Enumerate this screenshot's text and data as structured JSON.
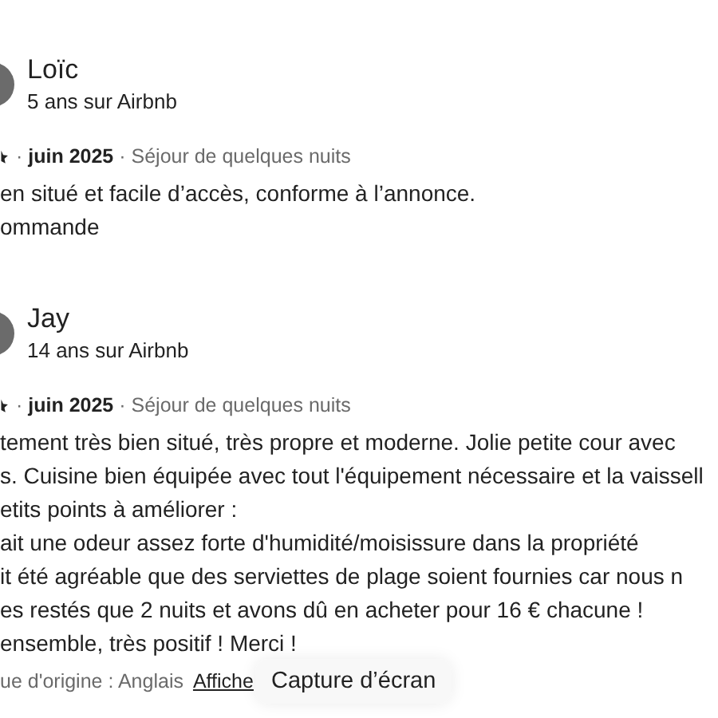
{
  "reviews": [
    {
      "name": "Loïc",
      "tenure": "5 ans sur Airbnb",
      "meta": "· **juin 2025** · Séjour de quelques nuits",
      "lines": [
        "en situé et facile d’accès, conforme à l’annonce.",
        "ommande"
      ]
    },
    {
      "name": "Jay",
      "tenure": "14 ans sur Airbnb",
      "meta": "· **juin 2025** · Séjour de quelques nuits",
      "lines": [
        "tement très bien situé, très propre et moderne. Jolie petite cour avec",
        "s. Cuisine bien équipée avec tout l'équipement nécessaire et la vaissell",
        "etits points à améliorer :",
        "ait une odeur assez forte d'humidité/moisissure dans la propriété",
        "it été agréable que des serviettes de plage soient fournies car nous n",
        "es restés que 2 nuits et avons dû en acheter pour 16 € chacune !",
        "ensemble, très positif ! Merci !"
      ],
      "language": "ue d'origine : Anglais",
      "link": "Affiche"
    }
  ],
  "tooltip": "Capture d’écran"
}
